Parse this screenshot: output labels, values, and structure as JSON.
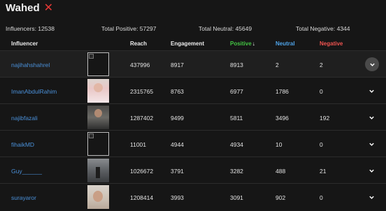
{
  "title": "Wahed",
  "close_symbol": "✕",
  "stats": {
    "influencers": "Influencers: 12538",
    "total_positive": "Total Positive: 57297",
    "total_neutral": "Total Neutral: 45649",
    "total_negative": "Total Negative: 4344"
  },
  "table": {
    "columns": {
      "influencer": "Influencer",
      "reach": "Reach",
      "engagement": "Engagement",
      "positive": "Positive",
      "neutral": "Neutral",
      "negative": "Negative"
    },
    "sort_arrow": "↓",
    "rows": [
      {
        "name": "najihahshahrel",
        "reach": "437996",
        "engagement": "8917",
        "positive": "8913",
        "neutral": "2",
        "negative": "2"
      },
      {
        "name": "ImanAbdulRahim",
        "reach": "2315765",
        "engagement": "8763",
        "positive": "6977",
        "neutral": "1786",
        "negative": "0"
      },
      {
        "name": "najibfazali",
        "reach": "1287402",
        "engagement": "9499",
        "positive": "5811",
        "neutral": "3496",
        "negative": "192"
      },
      {
        "name": "fihaikMD",
        "reach": "11001",
        "engagement": "4944",
        "positive": "4934",
        "neutral": "10",
        "negative": "0"
      },
      {
        "name": "Guy______",
        "reach": "1026672",
        "engagement": "3791",
        "positive": "3282",
        "neutral": "488",
        "negative": "21"
      },
      {
        "name": "surayaror",
        "reach": "1208414",
        "engagement": "3993",
        "positive": "3091",
        "neutral": "902",
        "negative": "0"
      }
    ]
  },
  "colors": {
    "positive": "#43c543",
    "neutral": "#4ea3e8",
    "negative": "#ef5350",
    "link": "#4a90d9",
    "close": "#e53935"
  },
  "icons": {
    "close": "close-icon",
    "sort": "arrow-down-icon",
    "expand": "chevron-down-icon"
  }
}
